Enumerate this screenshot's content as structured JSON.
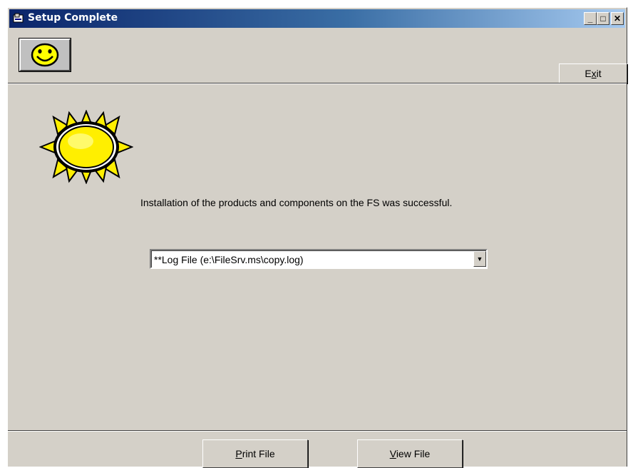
{
  "window": {
    "title": "Setup Complete",
    "title_icon": "setup-app-icon",
    "controls": {
      "minimize": "_",
      "maximize": "□",
      "close": "✕"
    }
  },
  "toolbar": {
    "status_icon": "smiley-face-icon",
    "exit": {
      "pre": "E",
      "accel": "x",
      "post": "it"
    }
  },
  "main": {
    "image": "sun-icon",
    "message": "Installation of the products and components on the FS was successful.",
    "log_select": {
      "value": "**Log File (e:\\FileSrv.ms\\copy.log)"
    }
  },
  "footer": {
    "print": {
      "accel": "P",
      "post": "rint File"
    },
    "view": {
      "accel": "V",
      "post": "iew File"
    }
  },
  "colors": {
    "face": "#d4d0c8",
    "title_start": "#0a246a",
    "title_end": "#a6caf0",
    "sun": "#ffef00"
  }
}
